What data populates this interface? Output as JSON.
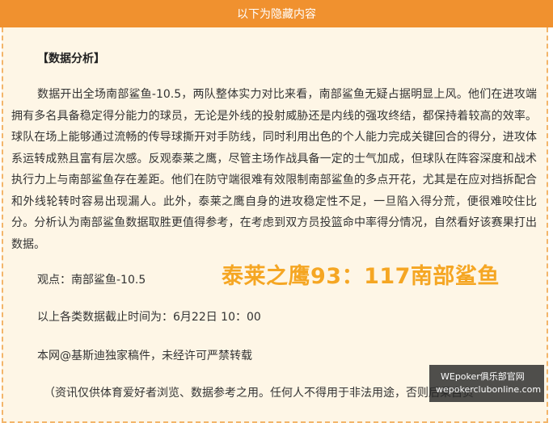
{
  "header": {
    "title": "以下为隐藏内容"
  },
  "article": {
    "section_title": "【数据分析】",
    "paragraph": "数据开出全场南部鲨鱼-10.5，两队整体实力对比来看，南部鲨鱼无疑占据明显上风。他们在进攻端拥有多名具备稳定得分能力的球员，无论是外线的投射威胁还是内线的强攻终结，都保持着较高的效率。球队在场上能够通过流畅的传导球撕开对手防线，同时利用出色的个人能力完成关键回合的得分，进攻体系运转成熟且富有层次感。反观泰莱之鹰，尽管主场作战具备一定的士气加成，但球队在阵容深度和战术执行力上与南部鲨鱼存在差距。他们在防守端很难有效限制南部鲨鱼的多点开花，尤其是在应对挡拆配合和外线轮转时容易出现漏人。此外，泰莱之鹰自身的进攻稳定性不足，一旦陷入得分荒，便很难咬住比分。分析认为南部鲨鱼数据取胜更值得参考，在考虑到双方员投篮命中率得分情况，自然看好该赛果打出数据。",
    "opinion": "观点：南部鲨鱼-10.5",
    "score_prediction": "泰莱之鹰93：117南部鲨鱼",
    "deadline": "以上各类数据截止时间为：6月22日 10：00",
    "copyright": "本网@基斯迪独家稿件，未经许可严禁转载",
    "disclaimer": "（资讯仅供体育爱好者浏览、数据参考之用。任何人不得用于非法用途，否则后果自负"
  },
  "watermark": {
    "line1": "WEpoker俱乐部官网",
    "line2": "wepokerclubonline.com"
  },
  "colors": {
    "header_bg": "#f0912f",
    "panel_bg": "#fef6e6",
    "border": "#f3b56a",
    "score": "#f5a623"
  }
}
